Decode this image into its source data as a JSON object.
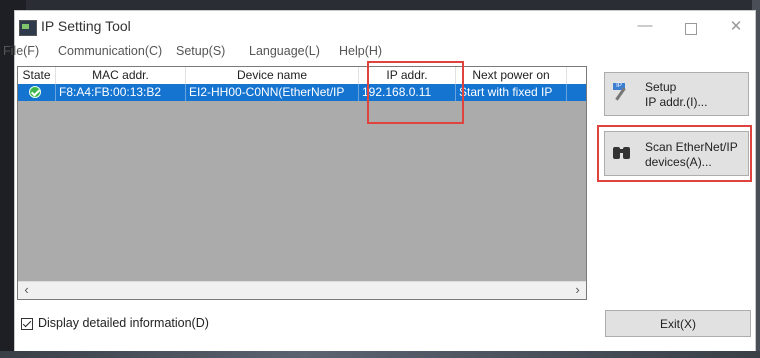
{
  "window": {
    "title": "IP Setting Tool"
  },
  "menu": [
    "File(F)",
    "Communication(C)",
    "Setup(S)",
    "Language(L)",
    "Help(H)"
  ],
  "table": {
    "columns": [
      "State",
      "MAC addr.",
      "Device name",
      "IP addr.",
      "Next power on"
    ],
    "rows": [
      {
        "mac": "F8:A4:FB:00:13:B2",
        "device": "EI2-HH00-C0NN(EtherNet/IP",
        "ip": "192.168.0.11",
        "next": "Start with fixed IP"
      }
    ]
  },
  "buttons": {
    "setup_line1": "Setup",
    "setup_line2": "IP addr.(I)...",
    "scan_line1": "Scan EtherNet/IP",
    "scan_line2": "devices(A)...",
    "exit": "Exit(X)"
  },
  "checkbox": {
    "label": "Display detailed information(D)",
    "checked": true
  },
  "colors": {
    "selection": "#1674d1",
    "highlight": "#e0433d",
    "list_bg": "#ababab"
  },
  "icons": [
    "app-icon",
    "state-ok-icon",
    "setup-ip-icon",
    "binoculars-icon"
  ]
}
